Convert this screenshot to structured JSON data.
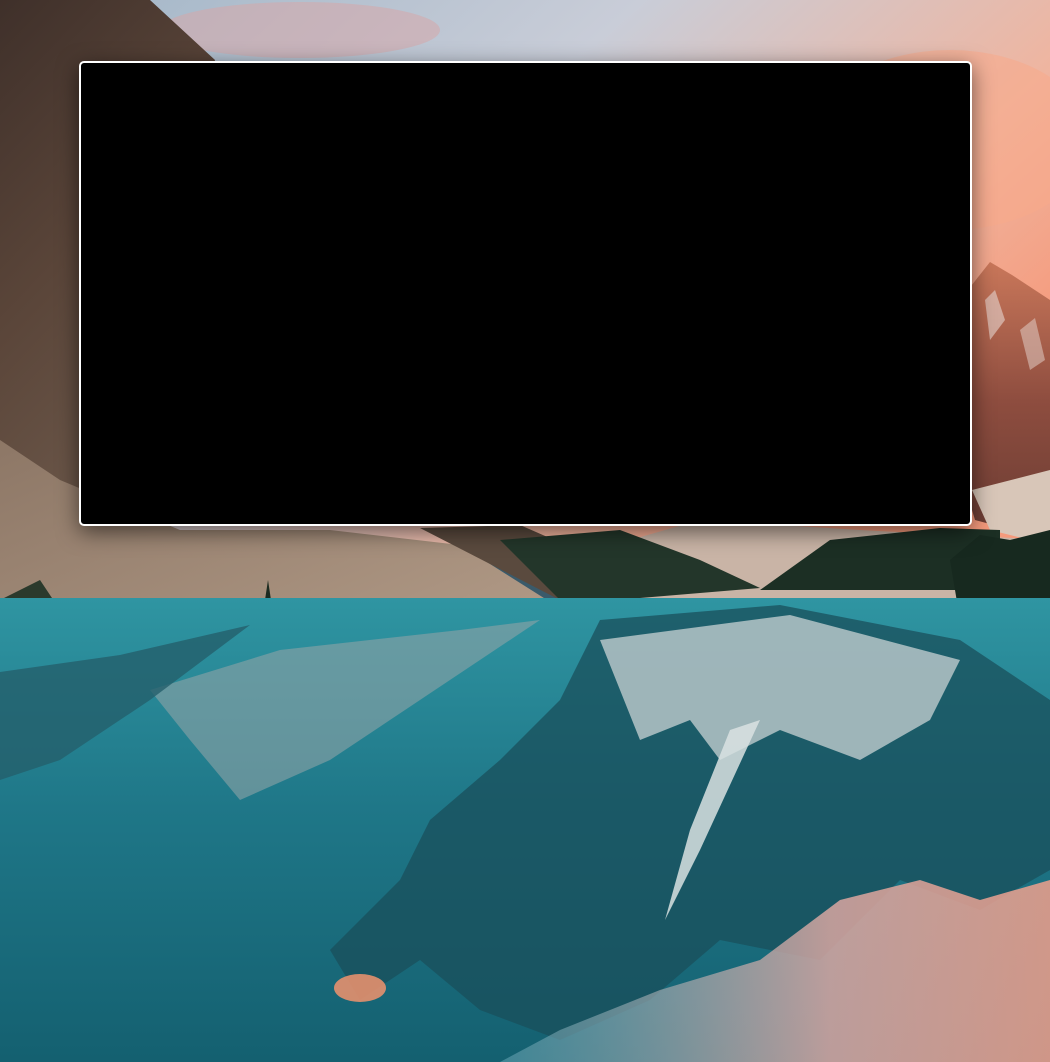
{
  "desktop": {
    "wallpaper_icon": "mountain-lake-landscape",
    "colors": {
      "sky_top": "#b9c9d6",
      "sky_sunset": "#f3a58a",
      "mountain_dark": "#4a3a32",
      "peak_lit": "#c06a52",
      "forest": "#1f3226",
      "lake_turquoise": "#2b8a98",
      "lake_deep": "#135a6a",
      "reflection_pink": "#e7a295"
    }
  },
  "window": {
    "background": "#000000",
    "border": "#ffffff"
  }
}
